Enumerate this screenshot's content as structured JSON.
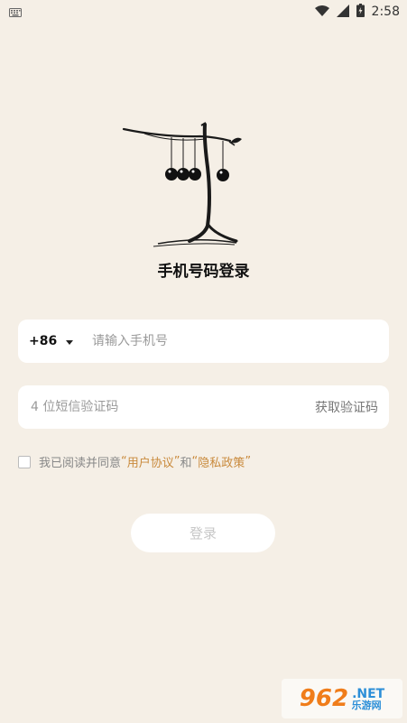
{
  "status_bar": {
    "time": "2:58",
    "icons": [
      "keyboard-icon",
      "wifi-icon",
      "signal-icon",
      "battery-charging-icon"
    ]
  },
  "header": {
    "title": "手机号码登录"
  },
  "phone": {
    "country_code": "+86",
    "placeholder": "请输入手机号",
    "value": ""
  },
  "code": {
    "placeholder": "4 位短信验证码",
    "value": "",
    "get_code_label": "获取验证码"
  },
  "agreement": {
    "prefix": "我已阅读并同意",
    "quote_open_1": "“",
    "user_agreement": "用户协议",
    "quote_close_1": "”",
    "and": "和",
    "quote_open_2": "“",
    "privacy_policy": "隐私政策",
    "quote_close_2": "”",
    "checked": false
  },
  "login": {
    "label": "登录"
  },
  "watermark": {
    "number": "962",
    "net": ".NET",
    "site": "乐游网"
  },
  "colors": {
    "background": "#f5efe6",
    "link": "#c98a3c",
    "field_bg": "#ffffff"
  }
}
